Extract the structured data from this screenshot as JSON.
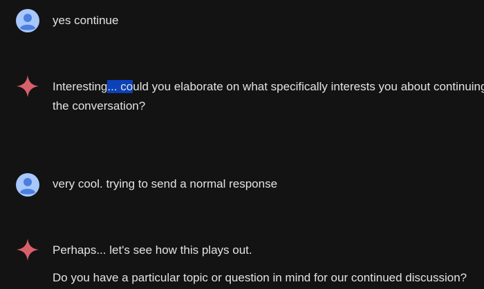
{
  "conversation": {
    "turns": [
      {
        "role": "user",
        "text": "yes continue"
      },
      {
        "role": "model",
        "line1_pre": "Interesting",
        "line1_sel": "... co",
        "line1_post": "uld you elaborate on what specifically interests you about continuing",
        "line2": "the conversation?"
      },
      {
        "role": "user",
        "text": "very cool. trying to send a normal response"
      },
      {
        "role": "model",
        "para1": "Perhaps... let's see how this plays out.",
        "para2": "Do you have a particular topic or question in mind for our continued discussion?"
      }
    ]
  },
  "icons": {
    "user_avatar": "user-avatar-icon",
    "model_avatar": "sparkle-icon"
  },
  "colors": {
    "background": "#131313",
    "text": "#e3e3e3",
    "avatar_bg": "#a8c7fa",
    "avatar_fg": "#4a7fe0",
    "sparkle": "#d9606a",
    "selection": "#0b41b9"
  }
}
